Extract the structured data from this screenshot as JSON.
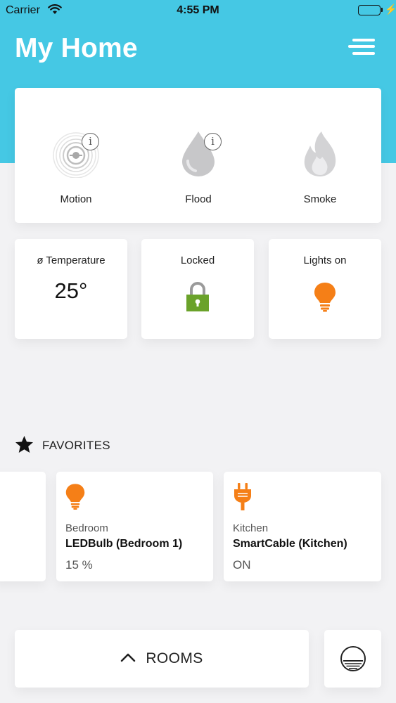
{
  "status_bar": {
    "carrier": "Carrier",
    "time": "4:55 PM",
    "battery_level": 1.0,
    "battery_color": "#4cd964"
  },
  "header": {
    "title": "My Home",
    "menu_icon": "hamburger-menu-icon",
    "background_color": "#45c8e4"
  },
  "sensors": [
    {
      "label": "Motion",
      "icon": "motion-sensor-icon",
      "info": "i"
    },
    {
      "label": "Flood",
      "icon": "water-drop-icon",
      "info": "i"
    },
    {
      "label": "Smoke",
      "icon": "flame-icon"
    }
  ],
  "stats": {
    "temperature": {
      "label": "ø Temperature",
      "value": "25°"
    },
    "lock": {
      "label": "Locked",
      "icon": "padlock-icon",
      "color": "#6aa22a"
    },
    "lights": {
      "label": "Lights on",
      "icon": "lightbulb-icon",
      "color": "#f57f17"
    }
  },
  "favorites": {
    "title": "FAVORITES",
    "icon": "star-icon",
    "items": [
      {
        "room": "Bedroom",
        "name": "LEDBulb (Bedroom 1)",
        "value": "15 %",
        "icon": "lightbulb-icon"
      },
      {
        "room": "Kitchen",
        "name": "SmartCable (Kitchen)",
        "value": "ON",
        "icon": "plug-icon"
      }
    ]
  },
  "footer": {
    "rooms_label": "ROOMS",
    "rooms_icon": "chevron-up-icon",
    "scene_icon": "scene-dial-icon"
  },
  "accent_orange": "#f57f17"
}
